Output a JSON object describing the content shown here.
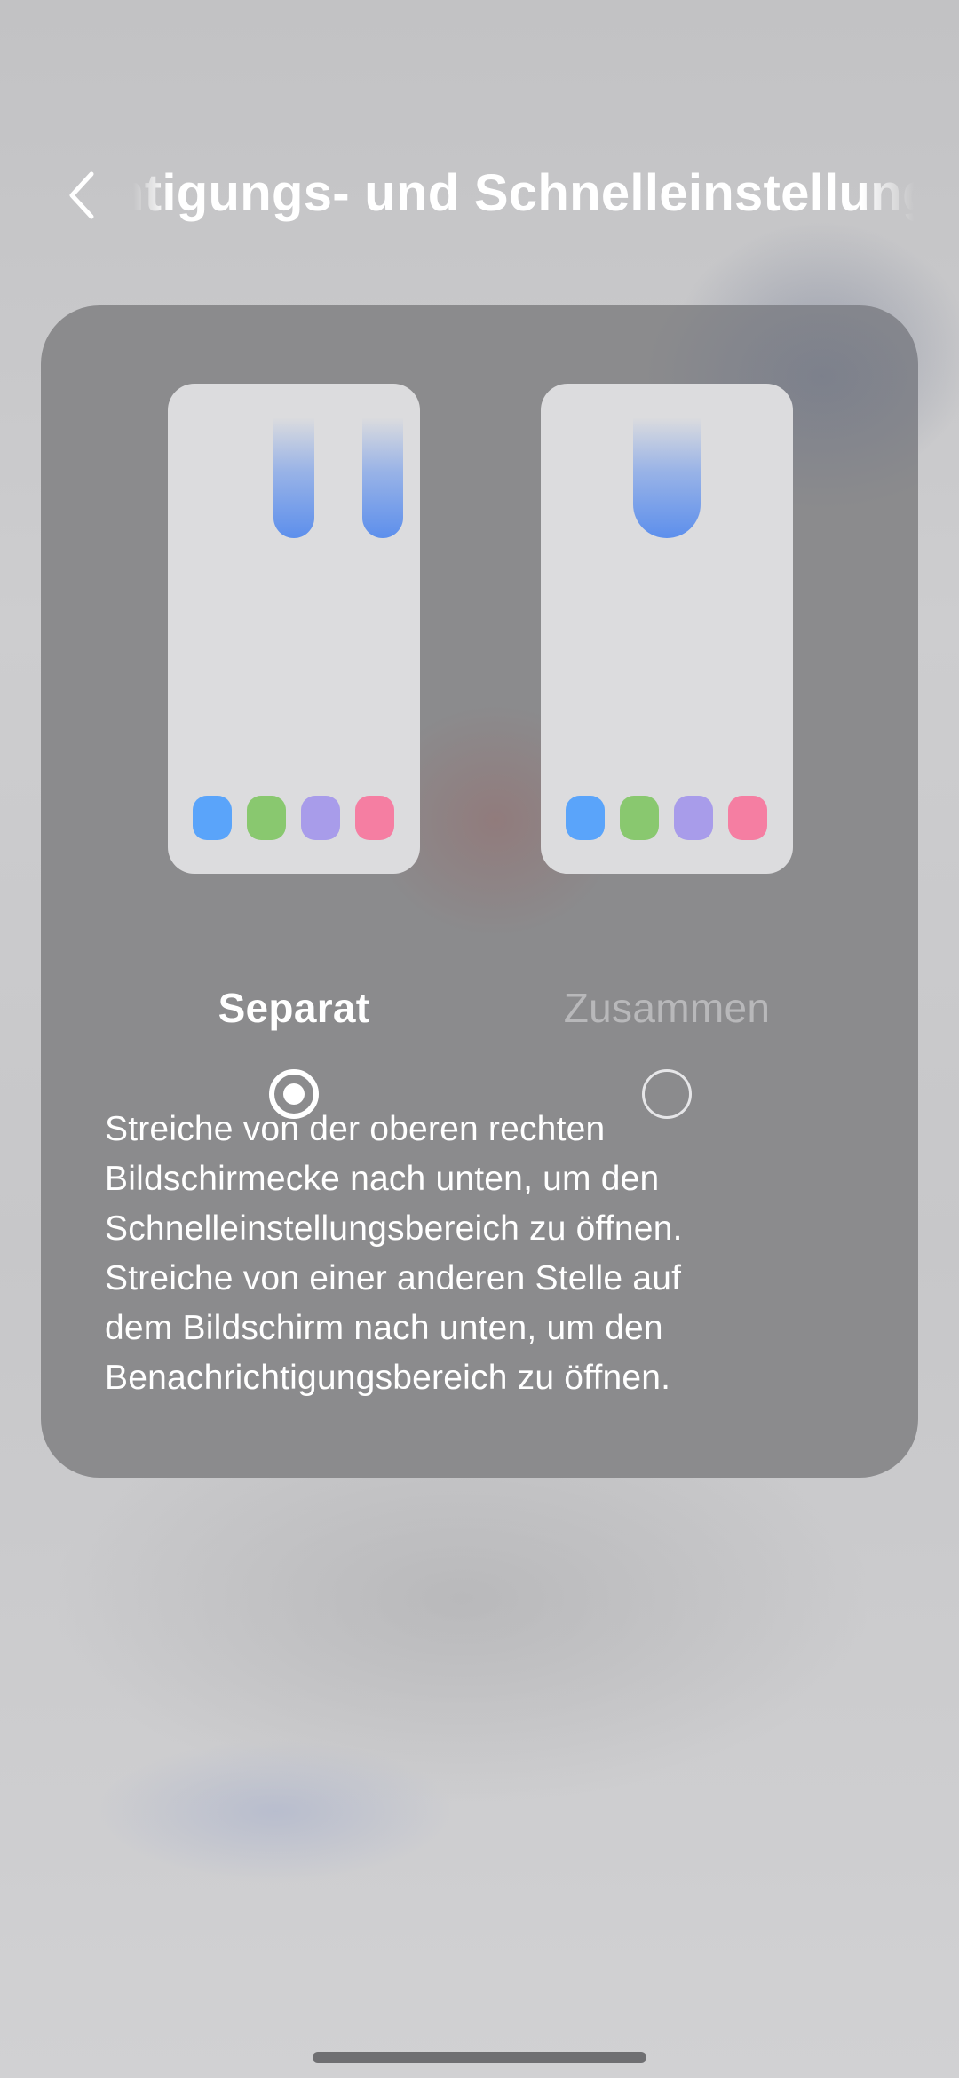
{
  "header": {
    "title": "Benachrichtigungs- und Schnelleinstellungen",
    "back_icon": "chevron-left-icon"
  },
  "options": [
    {
      "label": "Separat",
      "selected": true
    },
    {
      "label": "Zusammen",
      "selected": false
    }
  ],
  "description": {
    "lines": [
      "Streiche von der oberen rechten",
      "Bildschirmecke nach unten, um den",
      "Schnelleinstellungsbereich zu öffnen.",
      "Streiche von einer anderen Stelle auf",
      "dem Bildschirm nach unten, um den",
      "Benachrichtigungsbereich zu öffnen."
    ]
  },
  "colors": {
    "card_background": "#8b8b8d",
    "accent_blue": "#5d8fec",
    "dot_blue": "#5aa4fa",
    "dot_green": "#89c86f",
    "dot_purple": "#a89cea",
    "dot_pink": "#f57ea2"
  }
}
